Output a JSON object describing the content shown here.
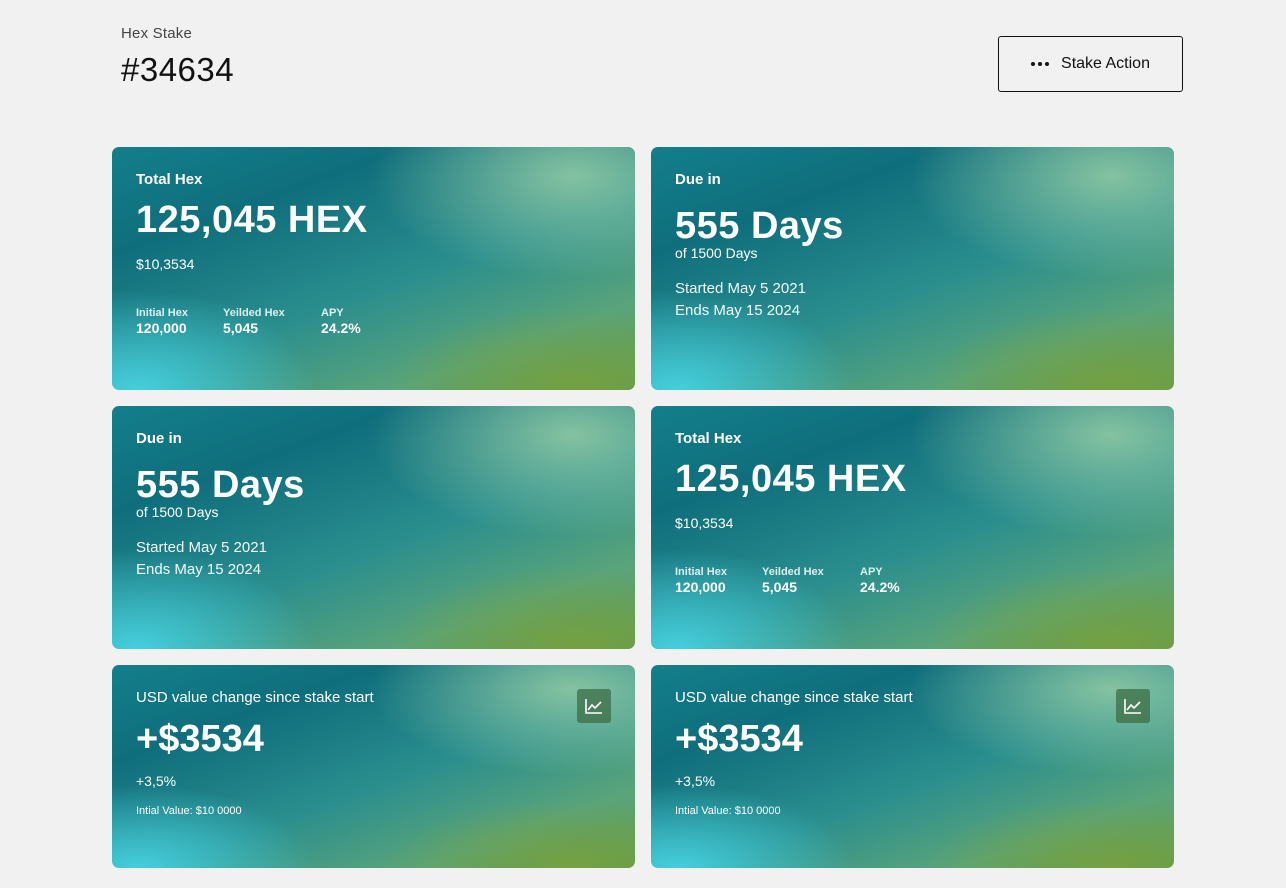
{
  "header": {
    "subtitle": "Hex Stake",
    "title": "#34634",
    "action_label": "Stake Action"
  },
  "cards": [
    {
      "type": "total",
      "label": "Total Hex",
      "amount": "125,045 HEX",
      "usd": "$10,3534",
      "stats": [
        {
          "label": "Initial Hex",
          "value": "120,000"
        },
        {
          "label": "Yeilded Hex",
          "value": "5,045"
        },
        {
          "label": "APY",
          "value": "24.2%"
        }
      ]
    },
    {
      "type": "due",
      "label": "Due in",
      "days": "555 Days",
      "of": "of 1500 Days",
      "started": "Started May 5 2021",
      "ends": "Ends May 15 2024"
    },
    {
      "type": "due",
      "label": "Due in",
      "days": "555 Days",
      "of": "of 1500 Days",
      "started": "Started May 5 2021",
      "ends": "Ends May 15 2024"
    },
    {
      "type": "total",
      "label": "Total Hex",
      "amount": "125,045 HEX",
      "usd": "$10,3534",
      "stats": [
        {
          "label": "Initial Hex",
          "value": "120,000"
        },
        {
          "label": "Yeilded Hex",
          "value": "5,045"
        },
        {
          "label": "APY",
          "value": "24.2%"
        }
      ]
    },
    {
      "type": "usd",
      "label": "USD value change since stake start",
      "change": "+$3534",
      "percent": "+3,5%",
      "initial": "Intial Value: $10 0000",
      "icon": "line-chart-icon"
    },
    {
      "type": "usd",
      "label": "USD value change since stake start",
      "change": "+$3534",
      "percent": "+3,5%",
      "initial": "Intial Value: $10 0000",
      "icon": "line-chart-icon"
    }
  ]
}
